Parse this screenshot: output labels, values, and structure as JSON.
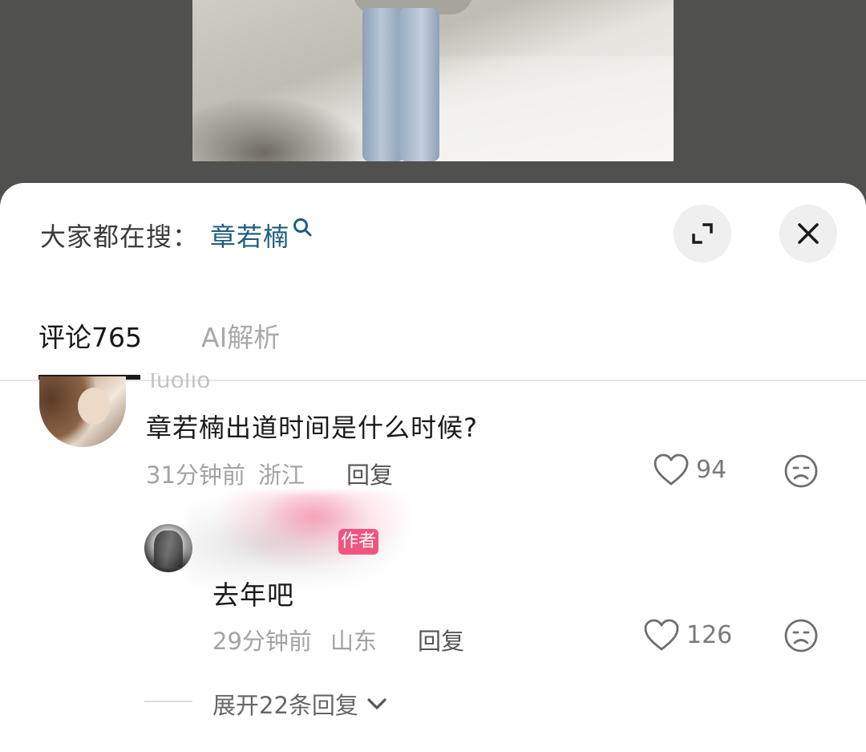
{
  "search_bar": {
    "prefix": "大家都在搜：",
    "term": "章若楠"
  },
  "tabs": [
    {
      "label": "评论765",
      "active": true
    },
    {
      "label": "AI解析",
      "active": false
    }
  ],
  "comments": [
    {
      "username_partial": "Tuolio",
      "text": "章若楠出道时间是什么时候?",
      "time": "31分钟前",
      "location": "浙江",
      "reply_label": "回复",
      "likes": "94",
      "replies": [
        {
          "badge": "作者",
          "text": "去年吧",
          "time": "29分钟前",
          "location": "山东",
          "reply_label": "回复",
          "likes": "126"
        }
      ],
      "expand_label": "展开22条回复"
    }
  ],
  "icons": {
    "search": "search-icon",
    "expand": "expand-icon",
    "close": "close-icon",
    "like": "heart-icon",
    "dislike": "frown-icon",
    "chevron": "chevron-down-icon"
  },
  "colors": {
    "accent_link": "#1f5d80",
    "author_badge": "#f0557f",
    "sheet_bg": "#ffffff",
    "backdrop": "#4f4f4d"
  }
}
